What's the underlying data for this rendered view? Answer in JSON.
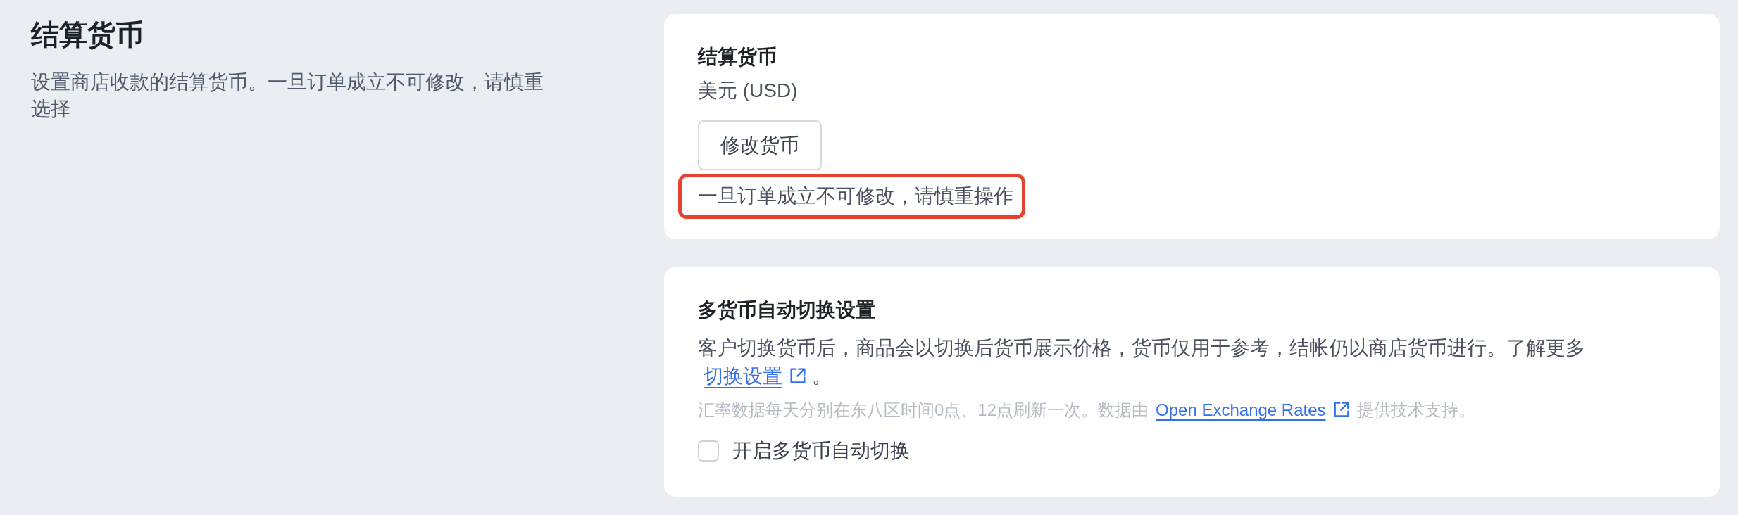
{
  "section": {
    "title": "结算货币",
    "description": "设置商店收款的结算货币。一旦订单成立不可修改，请慎重选择"
  },
  "currency_card": {
    "title": "结算货币",
    "value": "美元 (USD)",
    "button": "修改货币",
    "note": {
      "text": "一旦订单成立不可修改，请慎重操作",
      "highlighted": true
    }
  },
  "auto_switch_card": {
    "title": "多货币自动切换设置",
    "description": "客户切换货币后，商品会以切换后货币展示价格，货币仅用于参考，结帐仍以商店货币进行。了解更多",
    "link": "切换设置",
    "suffix": "。",
    "rates_note": {
      "before": "汇率数据每天分别在东八区时间0点、12点刷新一次。数据由",
      "link": "Open Exchange Rates",
      "after": "提供技术支持。"
    },
    "checkbox": {
      "label": "开启多货币自动切换",
      "checked": false
    }
  }
}
